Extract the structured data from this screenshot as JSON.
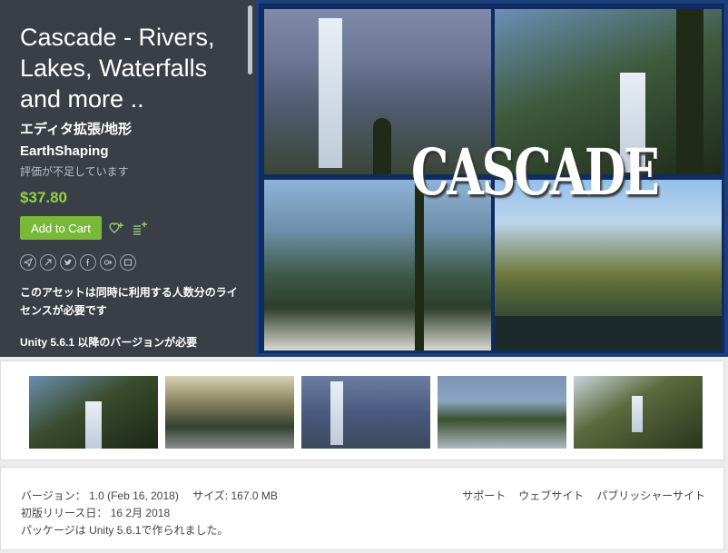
{
  "product": {
    "title": "Cascade - Rivers, Lakes, Waterfalls and more ..",
    "category": "エディタ拡張/地形",
    "publisher": "EarthShaping",
    "rating_text": "評価が不足しています",
    "price": "$37.80",
    "add_to_cart": "Add to Cart",
    "license_text": "このアセットは同時に利用する人数分のライセンスが必要です",
    "unity_requirement": "Unity 5.6.1 以降のバージョンが必要"
  },
  "hero": {
    "logo_text": "CASCADE"
  },
  "icons": {
    "wishlist": "wishlist-add-icon",
    "collection": "collection-add-icon",
    "share": [
      "share-icon",
      "circle-arrow-icon",
      "twitter-icon",
      "facebook-icon",
      "googleplus-icon",
      "embed-icon"
    ]
  },
  "details": {
    "version_line": "バージョン： 1.0 (Feb 16, 2018)　 サイズ: 167.0 MB",
    "release_line": "初版リリース日： 16 2月 2018",
    "package_line": "パッケージは Unity 5.6.1で作られました。",
    "links": {
      "support": "サポート",
      "website": "ウェブサイト",
      "publisher_site": "パブリッシャーサイト"
    }
  },
  "colors": {
    "panel_bg": "#3a3f47",
    "price": "#8fd23f",
    "cart_button": "#7ab83a",
    "hero_border": "#1d3f7c"
  }
}
